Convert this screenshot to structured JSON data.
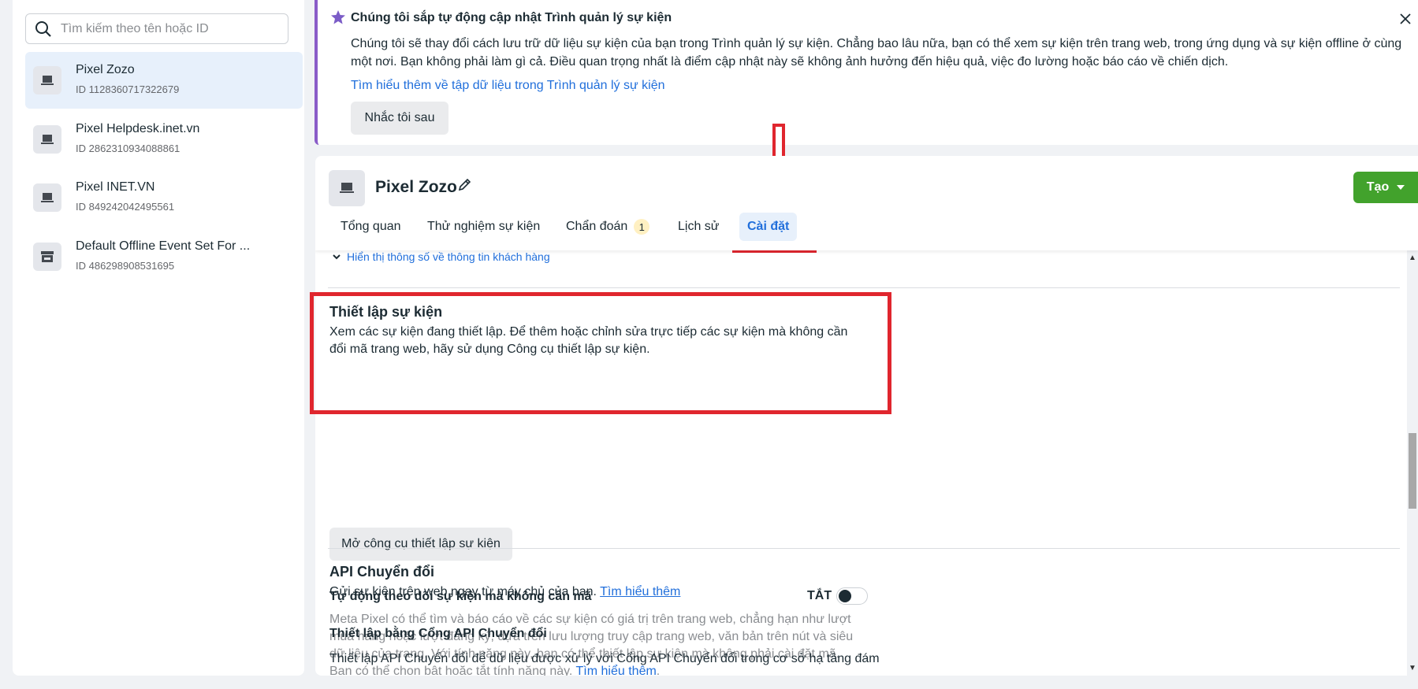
{
  "sidebar": {
    "search_placeholder": "Tìm kiếm theo tên hoặc ID",
    "items": [
      {
        "name": "Pixel Zozo",
        "id": "ID 1128360717322679",
        "icon": "laptop-icon",
        "active": true
      },
      {
        "name": "Pixel Helpdesk.inet.vn",
        "id": "ID 2862310934088861",
        "icon": "laptop-icon"
      },
      {
        "name": "Pixel INET.VN",
        "id": "ID 849242042495561",
        "icon": "laptop-icon"
      },
      {
        "name": "Default Offline Event Set For ...",
        "id": "ID 486298908531695",
        "icon": "store-icon"
      }
    ]
  },
  "banner": {
    "title": "Chúng tôi sắp tự động cập nhật Trình quản lý sự kiện",
    "body": "Chúng tôi sẽ thay đổi cách lưu trữ dữ liệu sự kiện của bạn trong Trình quản lý sự kiện. Chẳng bao lâu nữa, bạn có thể xem sự kiện trên trang web, trong ứng dụng và sự kiện offline ở cùng một nơi. Bạn không phải làm gì cả. Điều quan trọng nhất là điểm cập nhật này sẽ không ảnh hưởng đến hiệu quả, việc đo lường hoặc báo cáo về chiến dịch.",
    "link": "Tìm hiểu thêm về tập dữ liệu trong Trình quản lý sự kiện",
    "button": "Nhắc tôi sau",
    "accent": "#8a5cc8"
  },
  "header": {
    "title": "Pixel Zozo",
    "create_label": "Tạo",
    "tabs": [
      {
        "label": "Tổng quan"
      },
      {
        "label": "Thử nghiệm sự kiện"
      },
      {
        "label": "Chẩn đoán",
        "badge": "1"
      },
      {
        "label": "Lịch sử"
      },
      {
        "label": "Cài đặt",
        "active": true
      }
    ]
  },
  "content": {
    "show_params": "Hiển thị thông số về thông tin khách hàng",
    "event_setup": {
      "title": "Thiết lập sự kiện",
      "desc": "Xem các sự kiện đang thiết lập. Để thêm hoặc chỉnh sửa trực tiếp các sự kiện mà không cần đổi mã trang web, hãy sử dụng Công cụ thiết lập sự kiện.",
      "button": "Mở công cụ thiết lập sự kiện"
    },
    "auto_track": {
      "title": "Tự động theo dõi sự kiện mà không cần mã",
      "toggle_label": "TẮT",
      "toggle_on": false,
      "desc": "Meta Pixel có thể tìm và báo cáo về các sự kiện có giá trị trên trang web, chẳng hạn như lượt mua hàng hoặc lượt đăng ký, dựa trên lưu lượng truy cập trang web, văn bản trên nút và siêu dữ liệu của trang. Với tính năng này, bạn có thể thiết lập sự kiện mà không phải cài đặt mã. Bạn có thể chọn bật hoặc tắt tính năng này.",
      "link": "Tìm hiểu thêm"
    },
    "conversions_api": {
      "title": "API Chuyển đổi",
      "desc": "Gửi sự kiện trên web ngay từ máy chủ của bạn.",
      "link": "Tìm hiểu thêm"
    },
    "gateway": {
      "title": "Thiết lập bằng Cổng API Chuyển đổi",
      "desc": "Thiết lập API Chuyển đổi để dữ liệu được xử lý với Cổng API Chuyển đổi trong cơ sở hạ tầng đám"
    }
  },
  "colors": {
    "highlight": "#e0262e",
    "link": "#216fdb",
    "create_button": "#42a22c"
  }
}
